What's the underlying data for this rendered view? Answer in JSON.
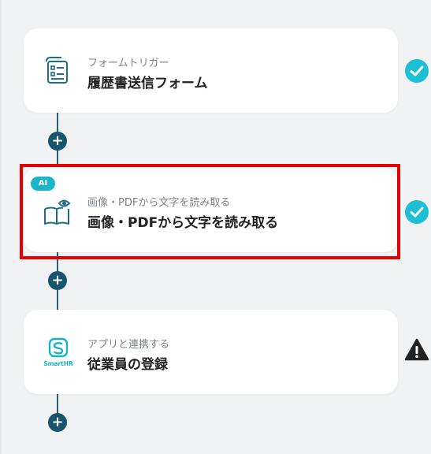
{
  "steps": [
    {
      "subtitle": "フォームトリガー",
      "title": "履歴書送信フォーム",
      "icon": "form-icon",
      "status": "check"
    },
    {
      "subtitle": "画像・PDFから文字を読み取る",
      "title": "画像・PDFから文字を読み取る",
      "icon": "book-eye-icon",
      "badge": "AI",
      "status": "check"
    },
    {
      "subtitle": "アプリと連携する",
      "title": "従業員の登録",
      "icon": "smarthr-icon",
      "icon_text": "SmartHR",
      "status": "warning"
    }
  ],
  "add_label": "+",
  "colors": {
    "check": "#1bc0d4",
    "warning": "#222222",
    "connector": "#17556e",
    "highlight": "#e60000"
  }
}
